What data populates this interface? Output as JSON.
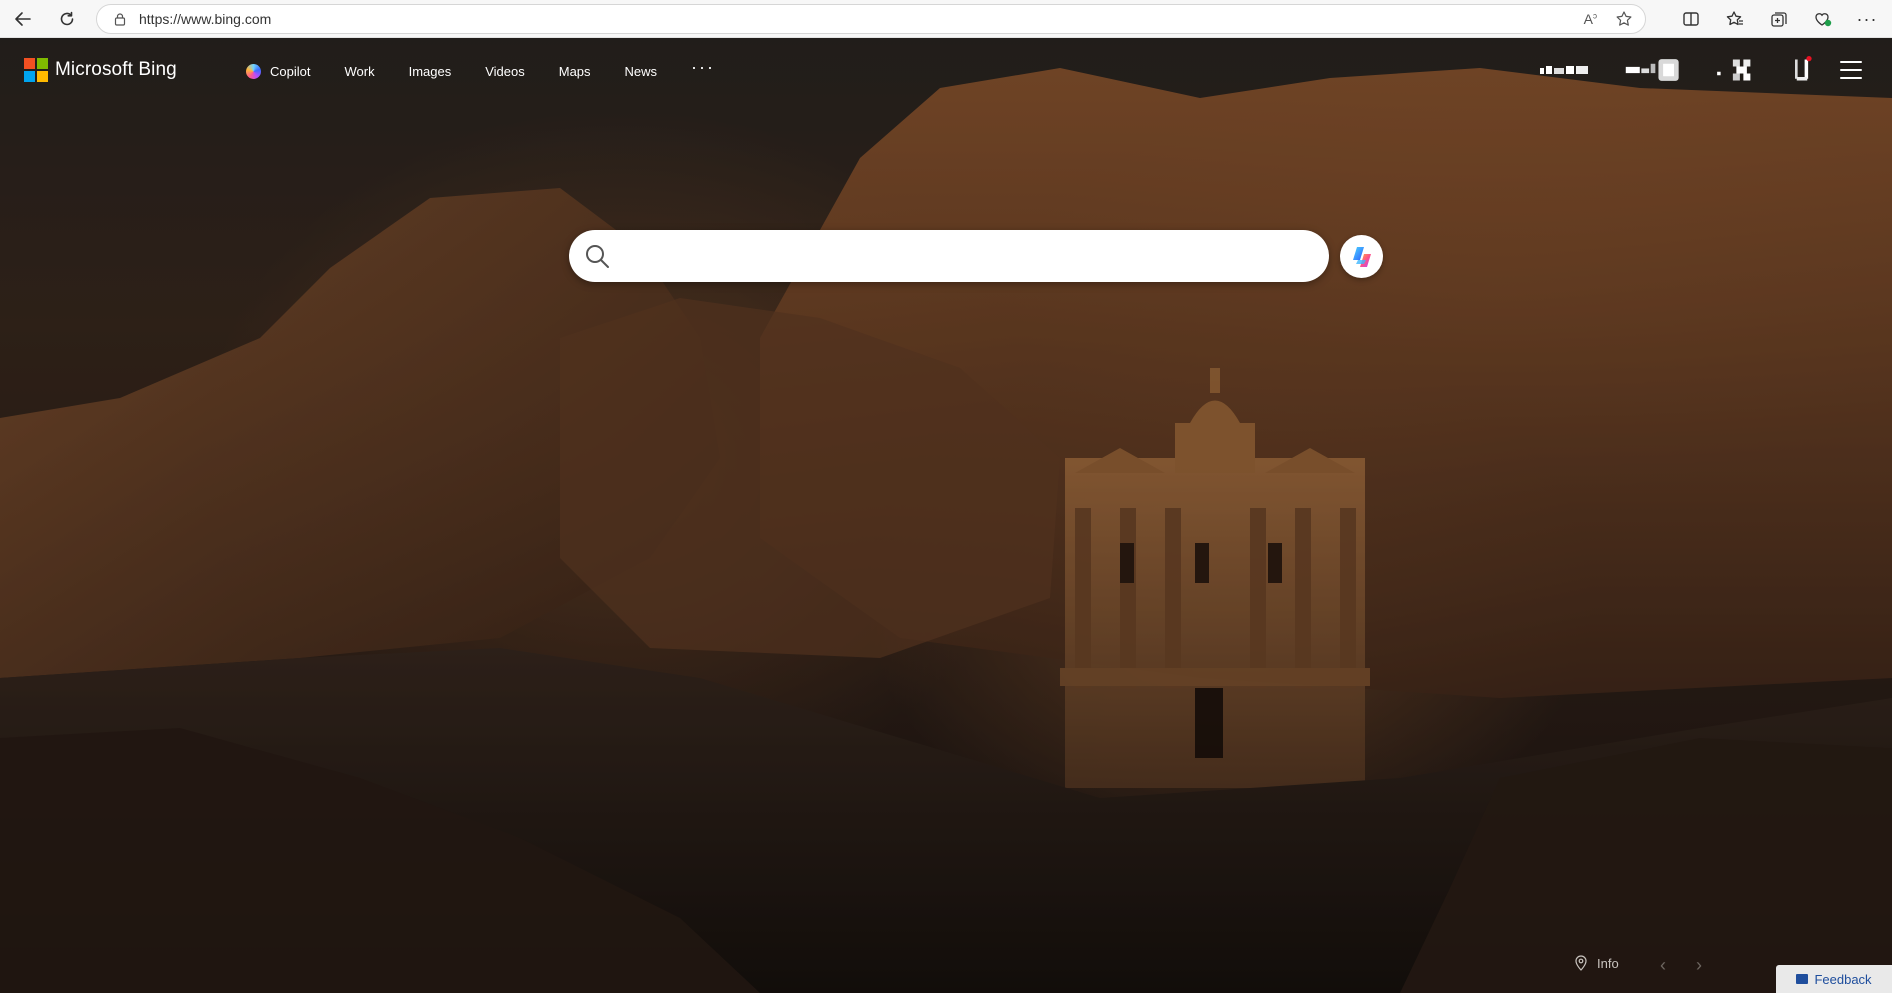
{
  "browser": {
    "url": "https://www.bing.com",
    "icons": [
      "back-arrow-icon",
      "refresh-icon",
      "lock-icon",
      "read-aloud-icon",
      "favorite-star-icon",
      "split-screen-icon",
      "favorites-icon",
      "collections-icon",
      "browser-essentials-icon",
      "more-icon"
    ]
  },
  "header": {
    "brand": "Microsoft Bing",
    "logo_colors": [
      "#f25022",
      "#7fba00",
      "#00a4ef",
      "#ffb900"
    ],
    "nav": [
      {
        "label": "Copilot"
      },
      {
        "label": "Work"
      },
      {
        "label": "Images"
      },
      {
        "label": "Videos"
      },
      {
        "label": "Maps"
      },
      {
        "label": "News"
      }
    ],
    "more_label": "···"
  },
  "search": {
    "value": "",
    "placeholder": ""
  },
  "footer": {
    "info_label": "Info",
    "feedback_label": "Feedback"
  }
}
